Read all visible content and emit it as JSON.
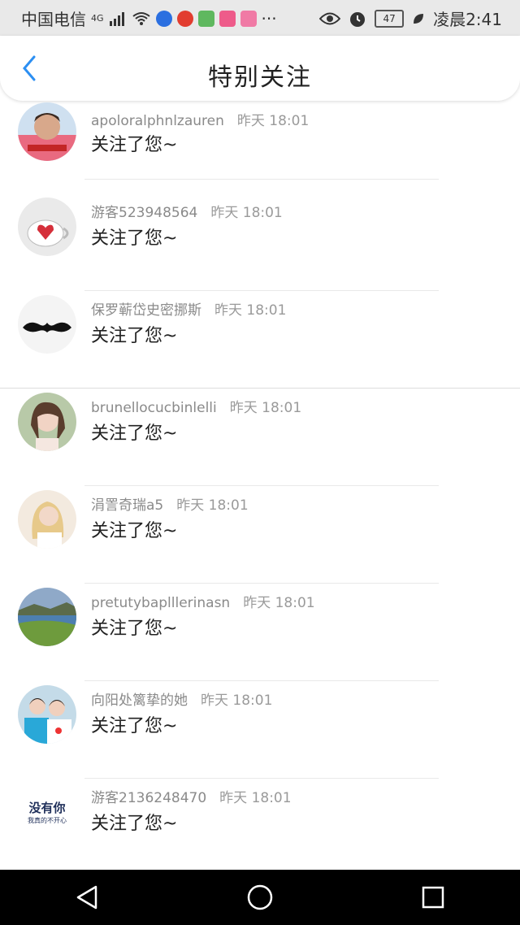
{
  "status": {
    "carrier": "中国电信",
    "network": "4G",
    "battery": "47",
    "time": "凌晨2:41",
    "more": "···"
  },
  "header": {
    "title": "特别关注",
    "back_icon": "chevron-left-icon",
    "accent": "#2c8ff2"
  },
  "rows": [
    {
      "name": "apoloralphnlzauren",
      "time": "昨天 18:01",
      "message": "关注了您~"
    },
    {
      "name": "游客523948564",
      "time": "昨天 18:01",
      "message": "关注了您~"
    },
    {
      "name": "保罗蕲岱史密挪斯",
      "time": "昨天 18:01",
      "message": "关注了您~"
    },
    {
      "name": "brunellocucbinlelli",
      "time": "昨天 18:01",
      "message": "关注了您~"
    },
    {
      "name": "涓詈奇瑞a5",
      "time": "昨天 18:01",
      "message": "关注了您~"
    },
    {
      "name": "pretutybaplllerinasn",
      "time": "昨天 18:01",
      "message": "关注了您~"
    },
    {
      "name": "向阳处篱挚的她",
      "time": "昨天 18:01",
      "message": "关注了您~"
    },
    {
      "name": "游客2136248470",
      "time": "昨天 18:01",
      "message": "关注了您~",
      "avatar_text": "没有你",
      "avatar_subtext": "我真的不开心"
    }
  ]
}
